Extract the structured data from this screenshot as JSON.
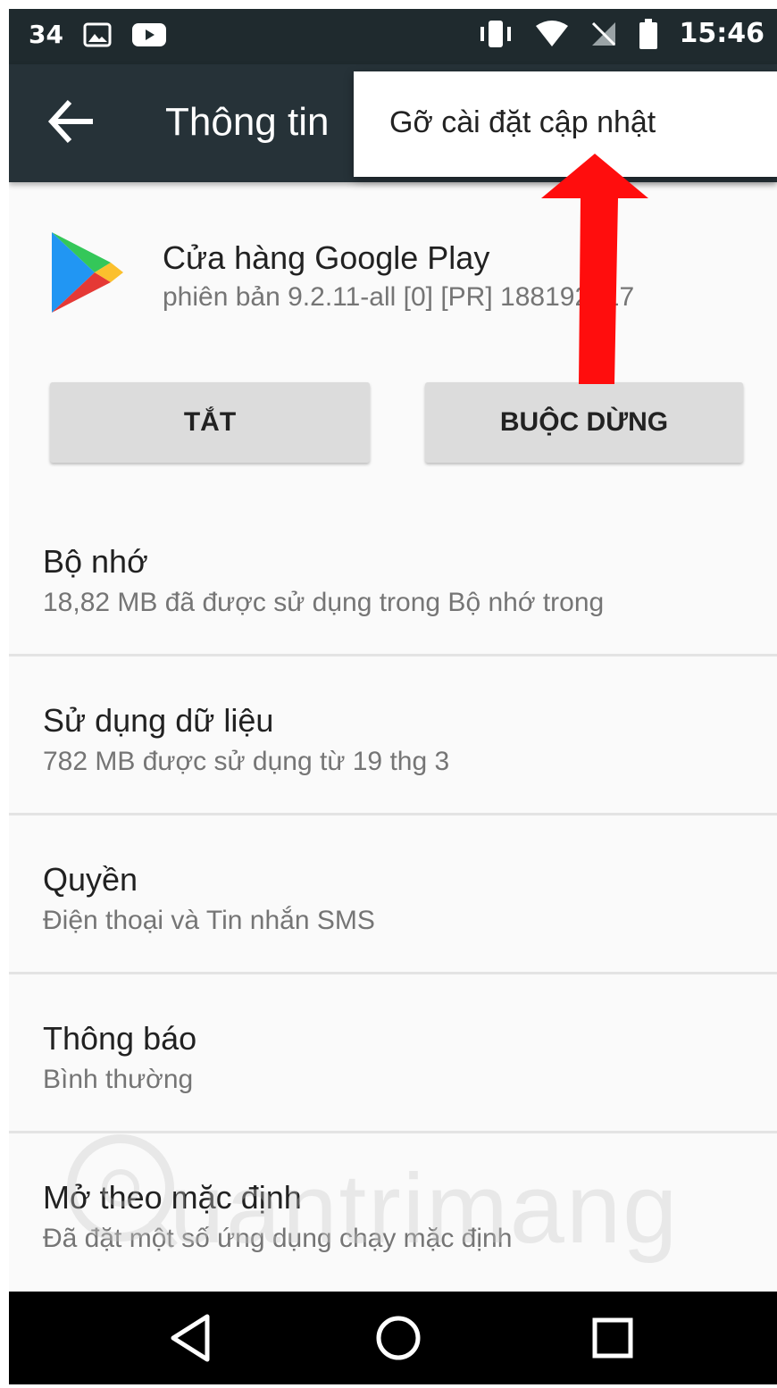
{
  "status_bar": {
    "notification_count": "34",
    "time": "15:46",
    "icons": [
      "image-icon",
      "youtube-icon",
      "vibrate-icon",
      "wifi-icon",
      "no-signal-icon",
      "battery-icon"
    ]
  },
  "toolbar": {
    "title": "Thông tin"
  },
  "overflow_menu": {
    "items": [
      {
        "label": "Gỡ cài đặt cập nhật"
      }
    ]
  },
  "app": {
    "name": "Cửa hàng Google Play",
    "version": "phiên bản 9.2.11-all [0] [PR] 188192317"
  },
  "actions": {
    "disable_label": "TẮT",
    "force_stop_label": "BUỘC DỪNG"
  },
  "settings": [
    {
      "title": "Bộ nhớ",
      "subtitle": "18,82 MB đã được sử dụng trong Bộ nhớ trong"
    },
    {
      "title": "Sử dụng dữ liệu",
      "subtitle": "782 MB được sử dụng từ 19 thg 3"
    },
    {
      "title": "Quyền",
      "subtitle": "Điện thoại và Tin nhắn SMS"
    },
    {
      "title": "Thông báo",
      "subtitle": "Bình thường"
    },
    {
      "title": "Mở theo mặc định",
      "subtitle": "Đã đặt một số ứng dụng chạy mặc định"
    }
  ],
  "watermark": {
    "text": "uantrimang"
  },
  "colors": {
    "toolbar": "#263238",
    "status_bar": "#1f2a2e",
    "button": "#dcdcdc",
    "arrow": "#ff0000"
  }
}
